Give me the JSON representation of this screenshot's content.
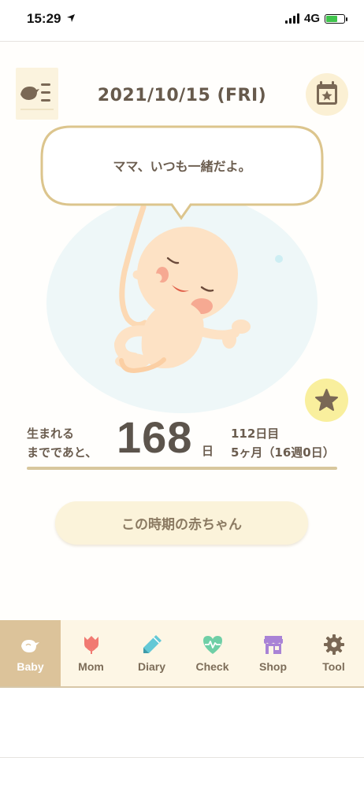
{
  "status_bar": {
    "time": "15:29",
    "network": "4G"
  },
  "header": {
    "date": "2021/10/15 (FRI)"
  },
  "bubble": {
    "message": "ママ、いつも一緒だよ。"
  },
  "countdown": {
    "left_line1": "生まれる",
    "left_line2": "までであと、",
    "days": "168",
    "unit": "日",
    "right_line1": "112日目",
    "right_line2": "5ヶ月（16週0日）"
  },
  "period_button": {
    "label": "この時期の赤ちゃん"
  },
  "tabs": [
    {
      "label": "Baby",
      "icon": "bird-icon",
      "active": true
    },
    {
      "label": "Mom",
      "icon": "tulip-icon",
      "active": false
    },
    {
      "label": "Diary",
      "icon": "pencil-icon",
      "active": false
    },
    {
      "label": "Check",
      "icon": "heartbeat-icon",
      "active": false
    },
    {
      "label": "Shop",
      "icon": "shop-icon",
      "active": false
    },
    {
      "label": "Tool",
      "icon": "gear-icon",
      "active": false
    }
  ],
  "colors": {
    "accent": "#dcc39a",
    "tab_bg": "#fdf6e5",
    "text": "#6b5d4f",
    "star": "#f9ef9d"
  }
}
